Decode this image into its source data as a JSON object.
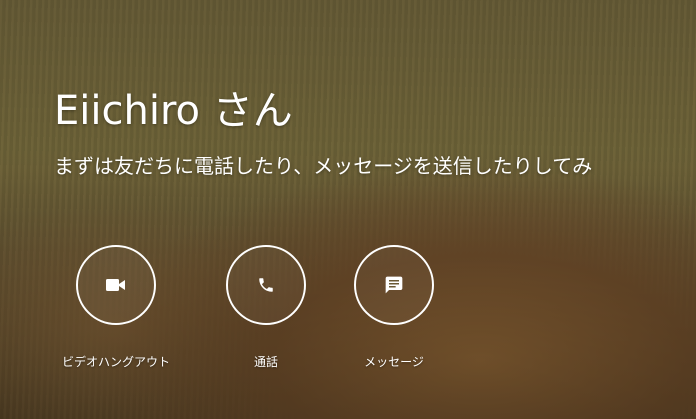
{
  "greeting": {
    "name_text": "Eiichiro さん"
  },
  "subtitle": "まずは友だちに電話したり、メッセージを送信したりしてみ",
  "actions": [
    {
      "label": "ビデオハングアウト",
      "icon": "video-camera-icon"
    },
    {
      "label": "通話",
      "icon": "phone-icon"
    },
    {
      "label": "メッセージ",
      "icon": "message-icon"
    }
  ],
  "colors": {
    "text": "#ffffff",
    "ring": "#ffffff"
  }
}
